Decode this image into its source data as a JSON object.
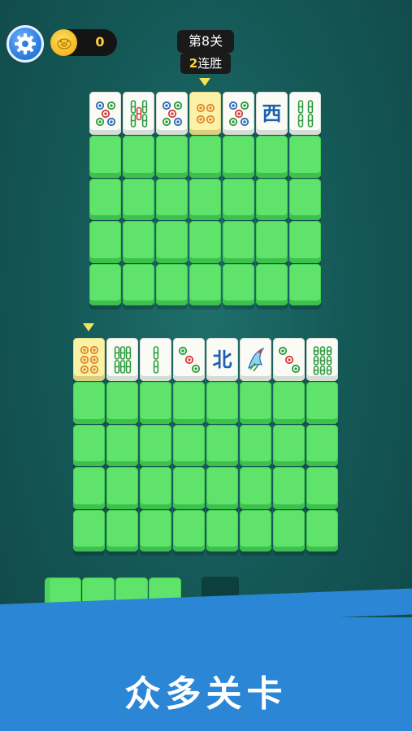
{
  "hud": {
    "settings_icon": "gear-icon",
    "coin_icon": "pig-coin-icon",
    "coins": "0",
    "level": "第8关",
    "streak_num": "2",
    "streak_label": "连胜"
  },
  "board_top": {
    "columns": 7,
    "tiles": [
      {
        "suit": "dots",
        "rank": 5
      },
      {
        "suit": "bamboo",
        "rank": 5
      },
      {
        "suit": "dots",
        "rank": 5
      },
      {
        "suit": "dots",
        "rank": 4,
        "highlighted": true
      },
      {
        "suit": "dots",
        "rank": 5
      },
      {
        "suit": "wind",
        "text": "西"
      },
      {
        "suit": "bamboo",
        "rank": 4
      }
    ],
    "hidden_rows": 4
  },
  "board_bottom": {
    "columns": 8,
    "tiles": [
      {
        "suit": "dots",
        "rank": 6,
        "highlighted": true
      },
      {
        "suit": "bamboo",
        "rank": 6
      },
      {
        "suit": "bamboo",
        "rank": 2
      },
      {
        "suit": "dots",
        "rank": 3
      },
      {
        "suit": "wind",
        "text": "北"
      },
      {
        "suit": "bamboo",
        "rank": 1
      },
      {
        "suit": "dots",
        "rank": 3
      },
      {
        "suit": "bamboo",
        "rank": 9
      }
    ],
    "hidden_rows": 4
  },
  "tray": {
    "filled_slots": 4
  },
  "banner": {
    "text": "众多关卡"
  },
  "colors": {
    "felt": "#155a58",
    "tile_back": "#5fe36a",
    "tile_face": "#fbfbf6",
    "highlight": "#fbf2a8",
    "banner": "#2b86d6",
    "marker": "#f3e35a"
  }
}
